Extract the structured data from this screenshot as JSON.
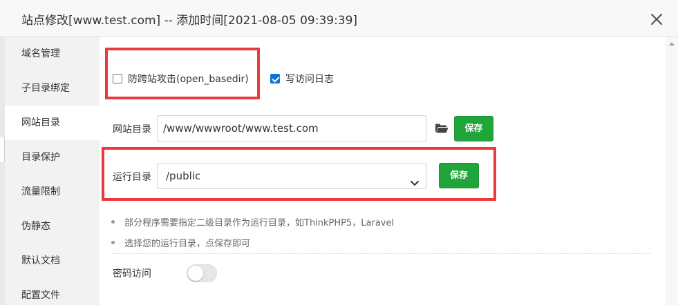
{
  "dialog": {
    "title": "站点修改[www.test.com] -- 添加时间[2021-08-05 09:39:39]"
  },
  "sidebar": {
    "items": [
      {
        "label": "域名管理"
      },
      {
        "label": "子目录绑定"
      },
      {
        "label": "网站目录",
        "active": true
      },
      {
        "label": "目录保护"
      },
      {
        "label": "流量限制"
      },
      {
        "label": "伪静态"
      },
      {
        "label": "默认文档"
      },
      {
        "label": "配置文件"
      }
    ]
  },
  "options": {
    "anti_cross_site": {
      "label": "防跨站攻击(open_basedir)",
      "checked": false
    },
    "access_log": {
      "label": "写访问日志",
      "checked": true
    }
  },
  "site_dir": {
    "label": "网站目录",
    "value": "/www/wwwroot/www.test.com",
    "save_label": "保存"
  },
  "run_dir": {
    "label": "运行目录",
    "value": "/public",
    "save_label": "保存"
  },
  "tips": [
    "部分程序需要指定二级目录作为运行目录，如ThinkPHP5，Laravel",
    "选择您的运行目录，点保存即可"
  ],
  "password_access": {
    "label": "密码访问",
    "enabled": false
  },
  "colors": {
    "accent_green": "#20a53a",
    "highlight_red": "#ea3a3e",
    "checkbox_blue": "#0a75d6"
  },
  "icons": {
    "close": "close-icon",
    "folder": "folder-open-icon",
    "select_chevron": "chevron-down-icon",
    "scroll_up": "scroll-up-arrow-icon"
  }
}
